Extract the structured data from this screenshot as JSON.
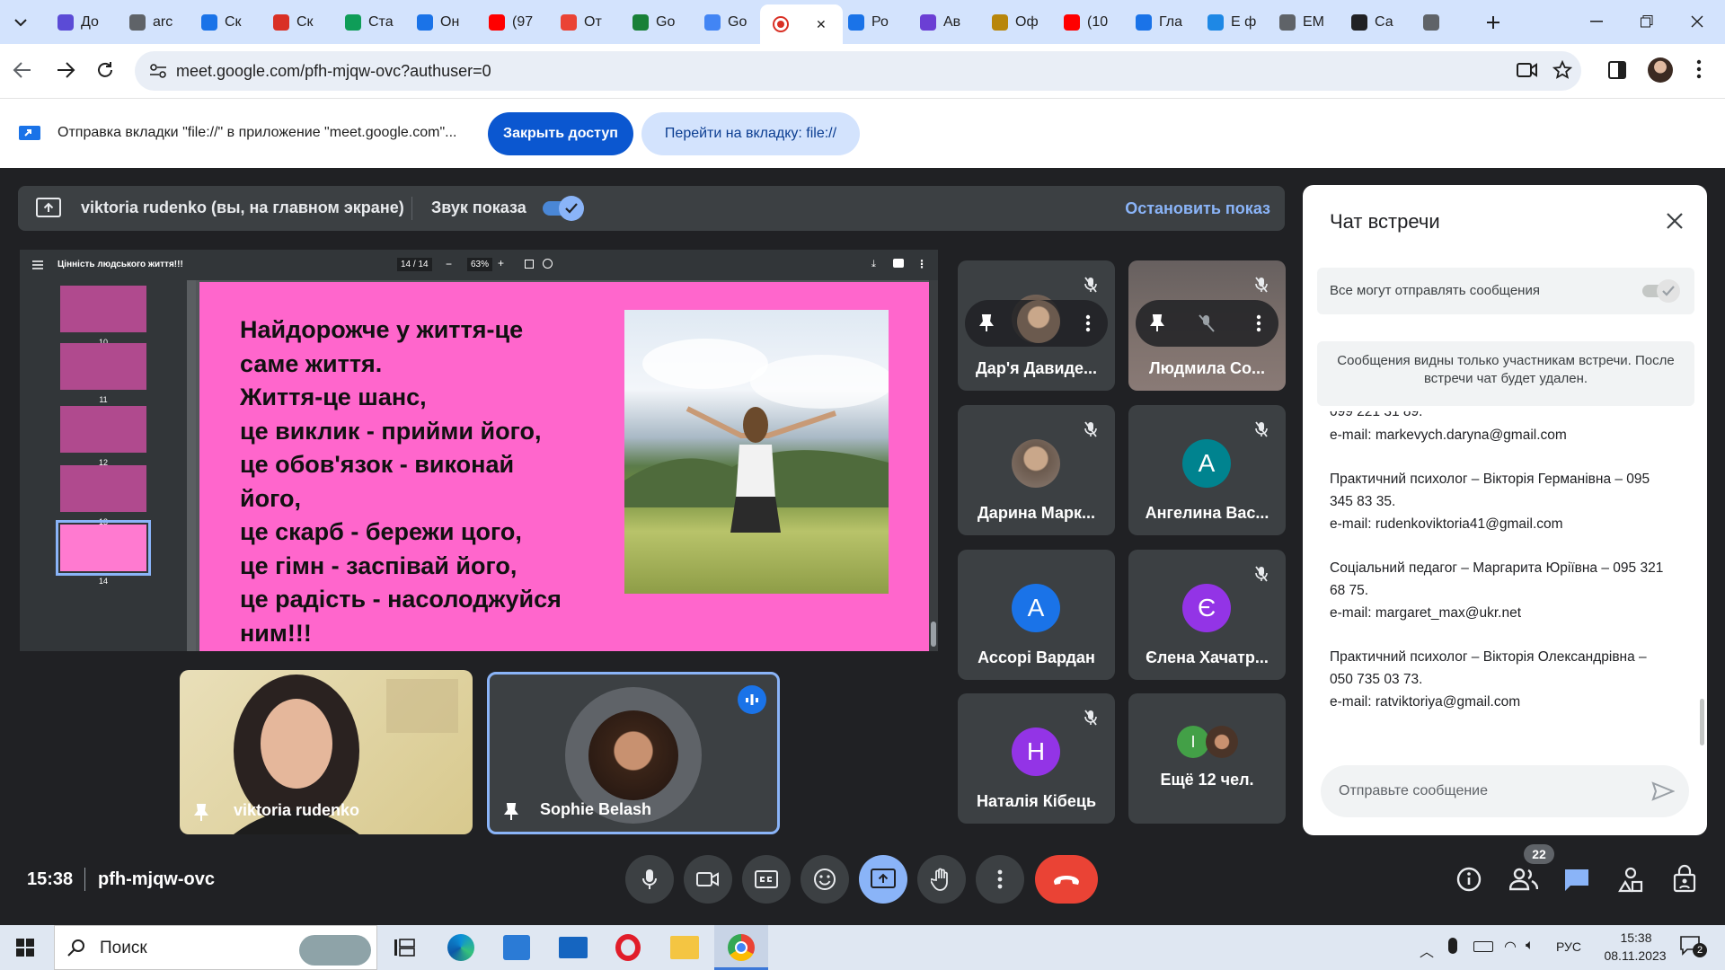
{
  "browser": {
    "tabs": [
      {
        "label": "До",
        "icon": "shield-icon",
        "color": "#5b4bd6"
      },
      {
        "label": "arc",
        "icon": "globe-icon",
        "color": "#5f6368"
      },
      {
        "label": "Ск",
        "icon": "bookmark-icon",
        "color": "#1a73e8"
      },
      {
        "label": "Ск",
        "icon": "heart-icon",
        "color": "#d93025"
      },
      {
        "label": "Ста",
        "icon": "sheet-icon",
        "color": "#0f9d58"
      },
      {
        "label": "Он",
        "icon": "ring-icon",
        "color": "#1a73e8"
      },
      {
        "label": "(97",
        "icon": "youtube-icon",
        "color": "#ff0000"
      },
      {
        "label": "От",
        "icon": "gmail-icon",
        "color": "#ea4335"
      },
      {
        "label": "Go",
        "icon": "classroom-icon",
        "color": "#188038"
      },
      {
        "label": "Go",
        "icon": "doc-icon",
        "color": "#4285f4"
      },
      {
        "label": "",
        "icon": "meet-record-icon",
        "color": "#d93025",
        "active": true
      },
      {
        "label": "Ро",
        "icon": "ring-icon",
        "color": "#1a73e8"
      },
      {
        "label": "Ав",
        "icon": "v-icon",
        "color": "#6b3fd4"
      },
      {
        "label": "Оф",
        "icon": "crest-icon",
        "color": "#b8860b"
      },
      {
        "label": "(10",
        "icon": "youtube-icon",
        "color": "#ff0000"
      },
      {
        "label": "Гла",
        "icon": "c-icon",
        "color": "#1a73e8"
      },
      {
        "label": "Е ф",
        "icon": "app-icon",
        "color": "#1e88e5"
      },
      {
        "label": "ЕМ",
        "icon": "page-icon",
        "color": "#5f6368"
      },
      {
        "label": "Са",
        "icon": "wiki-icon",
        "color": "#202124"
      },
      {
        "label": "",
        "icon": "globe-icon",
        "color": "#5f6368"
      }
    ],
    "url": "meet.google.com/pfh-mjqw-ovc?authuser=0",
    "infobar_text": "Отправка вкладки \"file://\" в приложение \"meet.google.com\"...",
    "stop_sharing_btn": "Закрыть доступ",
    "goto_tab_btn": "Перейти на вкладку: file://"
  },
  "presentation_bar": {
    "presenter": "viktoria rudenko (вы, на главном экране)",
    "audio_label": "Звук показа",
    "audio_on": true,
    "stop_label": "Остановить показ"
  },
  "slide_viewer": {
    "doc_title": "Цінність людського життя!!!",
    "page_indicator": "14 / 14",
    "zoom": "63%",
    "thumbnails": [
      "10",
      "11",
      "12",
      "13",
      "14"
    ],
    "current_thumbnail": "14",
    "slide_text": "Найдорожче у життя-це\nсаме життя.\nЖиття-це шанс,\nце виклик - прийми його,\nце обов'язок - виконай\nйого,\nце скарб - бережи цого,\nце гімн - заспівай його,\nце радість - насолоджуйся\nним!!!",
    "slide_bg": "#ff66cc"
  },
  "participants": [
    {
      "name": "Дар'я Давиде...",
      "type": "photo",
      "muted": true,
      "hover": true
    },
    {
      "name": "Людмила Со...",
      "type": "photo",
      "muted": true,
      "hover": true
    },
    {
      "name": "Дарина Марк...",
      "type": "photo",
      "muted": true
    },
    {
      "name": "Ангелина Вас...",
      "type": "letter",
      "letter": "А",
      "color": "#00838f",
      "muted": true
    },
    {
      "name": "Ассорі Вардан",
      "type": "letter",
      "letter": "А",
      "color": "#1a73e8",
      "muted": false
    },
    {
      "name": "Єлена Хачатр...",
      "type": "letter",
      "letter": "Є",
      "color": "#9334e6",
      "muted": true
    },
    {
      "name": "Наталія Кібець",
      "type": "letter",
      "letter": "Н",
      "color": "#9334e6",
      "muted": true
    },
    {
      "name": "Ещё 12 чел.",
      "type": "more",
      "letter": "I",
      "color": "#43a047",
      "muted": false
    }
  ],
  "self_tiles": [
    {
      "name": "viktoria rudenko"
    },
    {
      "name": "Sophie Belash",
      "speaking": true
    }
  ],
  "chat": {
    "title": "Чат встречи",
    "allow_label": "Все могут отправлять сообщения",
    "allow_on": true,
    "notice": "Сообщения видны только участникам встречи. После встречи чат будет удален.",
    "partial_line": "099 221 31 89.",
    "messages": [
      "e-mail: markevych.daryna@gmail.com",
      "Практичний психолог – Вікторія Германівна – 095 345 83 35.\ne-mail: rudenkoviktoria41@gmail.com",
      "Соціальний педагог – Маргарита Юріївна – 095 321 68 75.\ne-mail: margaret_max@ukr.net",
      "Практичний психолог – Вікторія Олександрівна – 050 735 03 73.\ne-mail: ratviktoriya@gmail.com"
    ],
    "input_placeholder": "Отправьте сообщение"
  },
  "meeting": {
    "time": "15:38",
    "code": "pfh-mjqw-ovc",
    "people_count": "22"
  },
  "taskbar": {
    "search_placeholder": "Поиск",
    "lang": "РУС",
    "time": "15:38",
    "date": "08.11.2023",
    "notifications": "2"
  },
  "colors": {
    "meet_bg": "#202124",
    "tile_bg": "#3c4043",
    "accent_blue": "#8ab4f8",
    "end_call_red": "#ea4335"
  }
}
